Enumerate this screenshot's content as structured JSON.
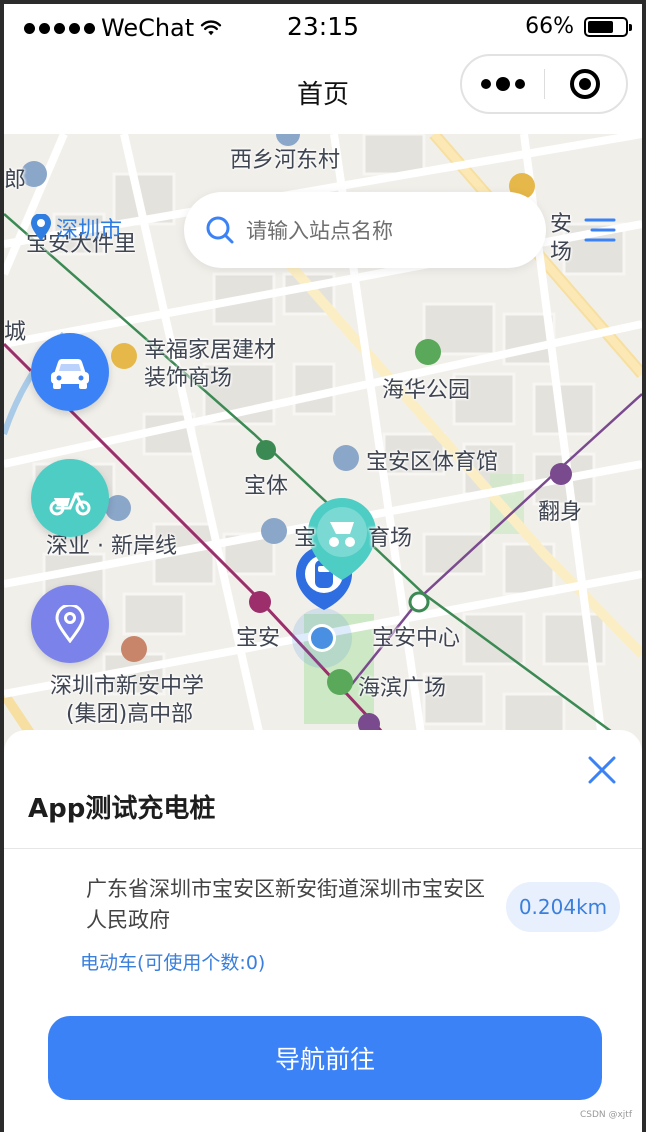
{
  "status_bar": {
    "carrier": "WeChat",
    "time": "23:15",
    "battery_percent": "66%",
    "battery_level": 0.66
  },
  "nav": {
    "title": "首页"
  },
  "search": {
    "placeholder": "请输入站点名称",
    "city": "深圳市"
  },
  "map": {
    "labels": [
      "西乡河东村",
      "宝安大件里",
      "幸福家居建材",
      "装饰商场",
      "海华公园",
      "宝安区体育馆",
      "宝体",
      "翻身",
      "深业 · 新岸线",
      "宝",
      "育场",
      "宝安",
      "宝安中心",
      "海滨广场",
      "深圳市新安中学",
      "(集团)高中部",
      "安",
      "场",
      "城",
      "郎"
    ]
  },
  "fabs": [
    "car-button",
    "scooter-button",
    "location-button"
  ],
  "station": {
    "name": "App测试充电桩",
    "address": "广东省深圳市宝安区新安街道深圳市宝安区人民政府",
    "distance": "0.204km",
    "availability": "电动车(可使用个数:0)"
  },
  "actions": {
    "navigate_label": "导航前往"
  },
  "watermark": "CSDN @xjtf",
  "colors": {
    "primary": "#3b82f6",
    "teal": "#4ecdc4",
    "purple": "#7b83ea",
    "map_bg": "#f1efea"
  }
}
